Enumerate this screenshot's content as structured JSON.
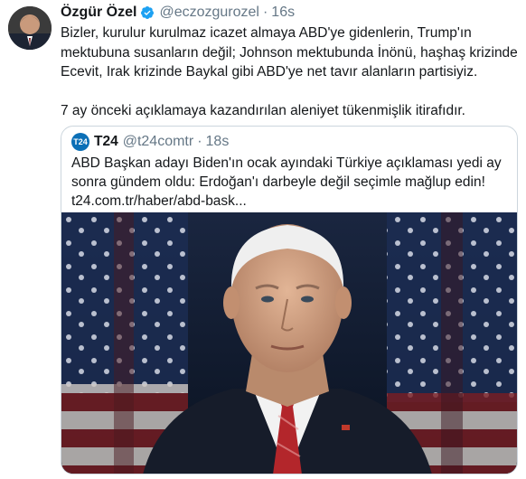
{
  "tweet": {
    "author_name": "Özgür Özel",
    "handle": "@eczozgurozel",
    "separator": "·",
    "time": "16s",
    "paragraph1": "Bizler, kurulur kurulmaz icazet almaya ABD'ye gidenlerin, Trump'ın mektubuna susanların değil; Johnson mektubunda İnönü, haşhaş krizinde Ecevit, Irak krizinde Baykal gibi ABD'ye net tavır alanların partisiyiz.",
    "paragraph2": "7 ay önceki açıklamaya kazandırılan aleniyet tükenmişlik itirafıdır."
  },
  "quoted": {
    "avatar_text": "T24",
    "author_name": "T24",
    "handle": "@t24comtr",
    "separator": "·",
    "time": "18s",
    "text": "ABD Başkan adayı Biden'ın ocak ayındaki Türkiye açıklaması yedi ay sonra gündem oldu: Erdoğan'ı darbeyle değil seçimle mağlup edin! t24.com.tr/haber/abd-bask..."
  },
  "colors": {
    "verified": "#1da1f2",
    "secondary_text": "#657786",
    "border": "#ccd6dd",
    "t24_brand": "#0b6fb6"
  },
  "icons": [
    "verified-badge-icon"
  ]
}
